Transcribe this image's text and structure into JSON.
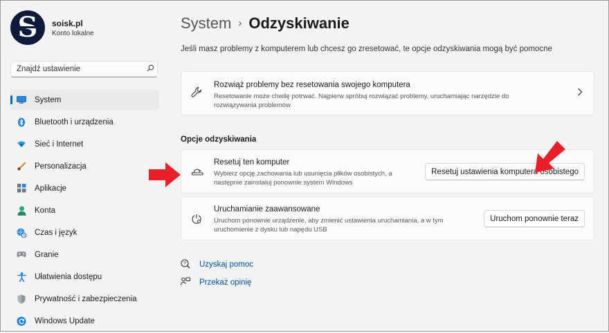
{
  "profile": {
    "avatar_letter": "S",
    "name": "soisk.pl",
    "account_type": "Konto lokalne"
  },
  "search": {
    "placeholder": "Znajdź ustawienie",
    "icon": "search-icon"
  },
  "nav": {
    "active": "System",
    "items": [
      {
        "label": "System",
        "icon": "monitor-icon"
      },
      {
        "label": "Bluetooth i urządzenia",
        "icon": "bluetooth-icon"
      },
      {
        "label": "Sieć i Internet",
        "icon": "wifi-icon"
      },
      {
        "label": "Personalizacja",
        "icon": "brush-icon"
      },
      {
        "label": "Aplikacje",
        "icon": "apps-icon"
      },
      {
        "label": "Konta",
        "icon": "person-icon"
      },
      {
        "label": "Czas i język",
        "icon": "globe-clock-icon"
      },
      {
        "label": "Granie",
        "icon": "gamepad-icon"
      },
      {
        "label": "Ułatwienia dostępu",
        "icon": "accessibility-icon"
      },
      {
        "label": "Prywatność i zabezpieczenia",
        "icon": "shield-icon"
      },
      {
        "label": "Windows Update",
        "icon": "update-icon"
      }
    ]
  },
  "header": {
    "breadcrumb_parent": "System",
    "separator": "›",
    "title": "Odzyskiwanie"
  },
  "description": "Jeśli masz problemy z komputerem lub chcesz go zresetować, te opcje odzyskiwania mogą być pomocne",
  "troubleshoot": {
    "title": "Rozwiąż problemy bez resetowania swojego komputera",
    "subtitle": "Resetowanie może chwilę potrwać. Najpierw spróbuj rozwiązać problemy, uruchamiając narzędzie do rozwiązywania problemów"
  },
  "section_title": "Opcje odzyskiwania",
  "reset": {
    "title": "Resetuj ten komputer",
    "subtitle": "Wybierz opcję zachowania lub usunięcia plików osobistych, a następnie zainstaluj ponownie system Windows",
    "button": "Resetuj ustawienia komputera osobistego"
  },
  "advanced": {
    "title": "Uruchamianie zaawansowane",
    "subtitle": "Uruchom ponownie urządzenie, aby zmienić ustawienia uruchamiania, a w tym uruchomienie z dysku lub napędu USB",
    "button": "Uruchom ponownie teraz"
  },
  "links": [
    {
      "label": "Uzyskaj pomoc",
      "icon": "help-icon"
    },
    {
      "label": "Przekaż opinię",
      "icon": "feedback-icon"
    }
  ],
  "colors": {
    "accent": "#0067c0",
    "annotation_arrow": "#e8202a",
    "link": "#0050a0"
  }
}
